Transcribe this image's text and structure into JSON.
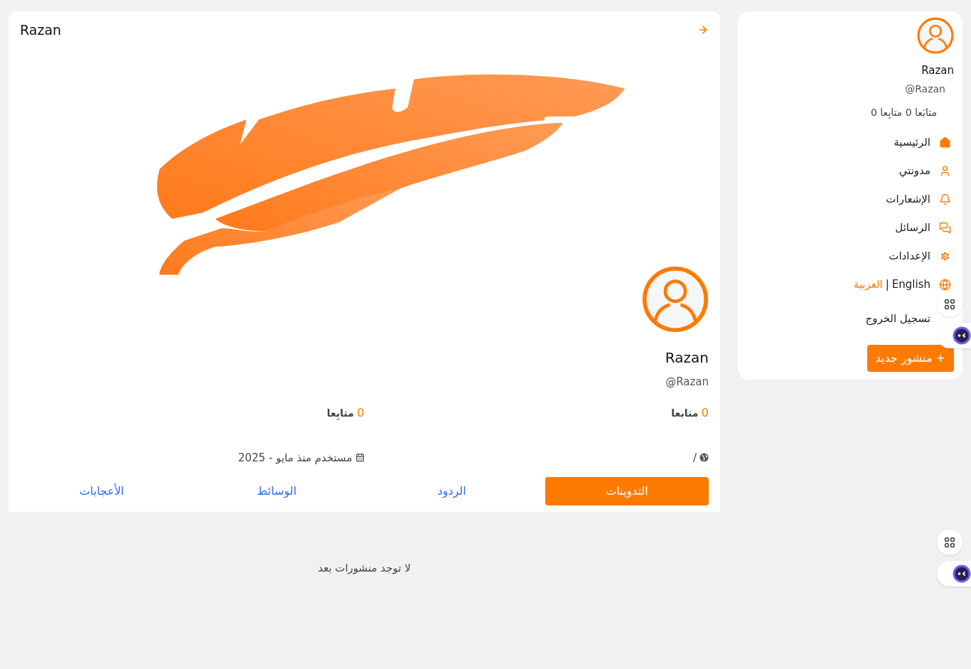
{
  "sidebar": {
    "name": "Razan",
    "handle": "@Razan",
    "follow_counts": "متابَعا 0 متابِعا 0",
    "nav": [
      {
        "kind": "home",
        "label": "الرئيسية"
      },
      {
        "kind": "user",
        "label": "مدونتي"
      },
      {
        "kind": "bell",
        "label": "الإشعارات"
      },
      {
        "kind": "chat",
        "label": "الرسائل"
      },
      {
        "kind": "gear",
        "label": "الإعدادات"
      },
      {
        "kind": "language",
        "label": "English",
        "separator": "|",
        "alt_label": "العربية"
      },
      {
        "kind": "logout",
        "label": "تسجيل الخروج"
      }
    ],
    "new_post_button": "+ منشور جديد"
  },
  "profile": {
    "header_title": "Razan",
    "name": "Razan",
    "handle": "@Razan",
    "stats": [
      {
        "count": "0",
        "label": "متابعا"
      },
      {
        "count": "0",
        "label": "متابِعا"
      }
    ],
    "website": "/",
    "joined": "مستخدم منذ مايو - 2025",
    "tabs": [
      {
        "label": "التدوينات",
        "selected": true
      },
      {
        "label": "الردود",
        "selected": false
      },
      {
        "label": "الوسائط",
        "selected": false
      },
      {
        "label": "الأعجابات",
        "selected": false
      }
    ]
  },
  "empty_message": "لا توجد منشورات بعد"
}
